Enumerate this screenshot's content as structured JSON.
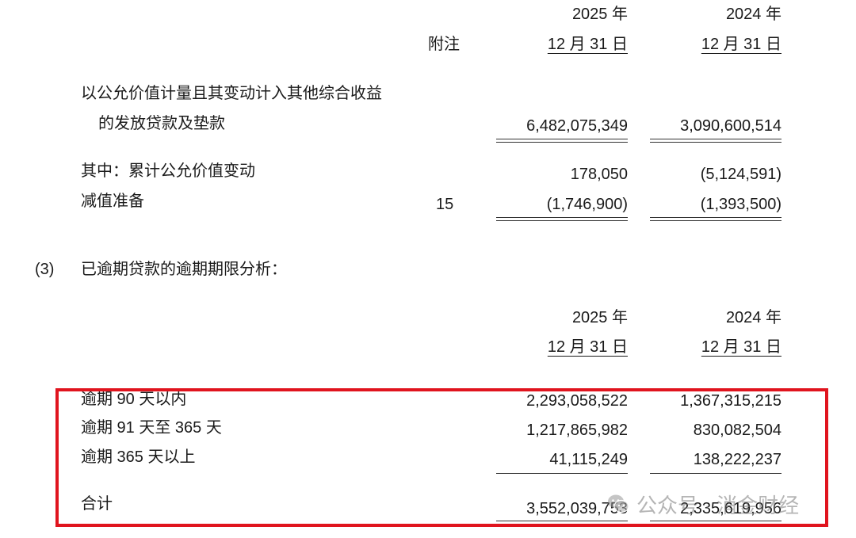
{
  "table1": {
    "header": {
      "note_label": "附注",
      "col1_year": "2025 年",
      "col1_date": "12 月 31 日",
      "col2_year": "2024 年",
      "col2_date": "12 月 31 日"
    },
    "rows": [
      {
        "label_line1": "以公允价值计量且其变动计入其他综合收益",
        "label_line2": "的发放贷款及垫款",
        "note": "",
        "v2025": "6,482,075,349",
        "v2024": "3,090,600,514"
      },
      {
        "label": "其中：累计公允价值变动",
        "note": "",
        "v2025": "178,050",
        "v2024": "(5,124,591)"
      },
      {
        "label": "减值准备",
        "note": "15",
        "v2025": "(1,746,900)",
        "v2024": "(1,393,500)"
      }
    ]
  },
  "section3": {
    "number": "(3)",
    "title": "已逾期贷款的逾期期限分析："
  },
  "table2": {
    "header": {
      "col1_year": "2025 年",
      "col1_date": "12 月 31 日",
      "col2_year": "2024 年",
      "col2_date": "12 月 31 日"
    },
    "rows": [
      {
        "label": "逾期 90 天以内",
        "v2025": "2,293,058,522",
        "v2024": "1,367,315,215"
      },
      {
        "label": "逾期 91 天至 365 天",
        "v2025": "1,217,865,982",
        "v2024": "830,082,504"
      },
      {
        "label": "逾期 365 天以上",
        "v2025": "41,115,249",
        "v2024": "138,222,237"
      }
    ],
    "total": {
      "label": "合计",
      "v2025": "3,552,039,753",
      "v2024": "2,335,619,956"
    }
  },
  "highlight_color": "#e0141e",
  "watermark": {
    "icon": "wechat-icon",
    "text": "公众号 · 消金财经"
  }
}
